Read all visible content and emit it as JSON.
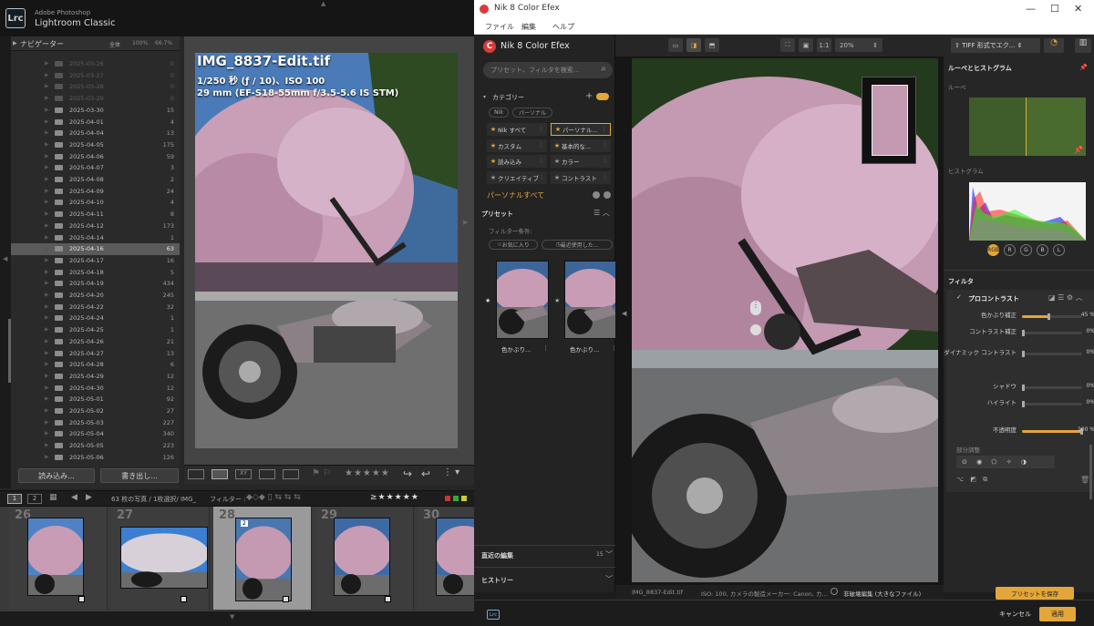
{
  "lightroom": {
    "brand_line1": "Adobe Photoshop",
    "brand_line2": "Lightroom Classic",
    "logo_text": "Lrc",
    "navigator": {
      "title": "ナビゲーター",
      "zoom_fit": "全体",
      "zoom_100": "100%",
      "zoom_667": "66.7%"
    },
    "folders": [
      {
        "name": "2025-03-26",
        "count": "0",
        "dim": true
      },
      {
        "name": "2025-03-27",
        "count": "0",
        "dim": true
      },
      {
        "name": "2025-03-28",
        "count": "0",
        "dim": true
      },
      {
        "name": "2025-03-29",
        "count": "0",
        "dim": true
      },
      {
        "name": "2025-03-30",
        "count": "15"
      },
      {
        "name": "2025-04-01",
        "count": "4"
      },
      {
        "name": "2025-04-04",
        "count": "13"
      },
      {
        "name": "2025-04-05",
        "count": "175"
      },
      {
        "name": "2025-04-06",
        "count": "59"
      },
      {
        "name": "2025-04-07",
        "count": "3"
      },
      {
        "name": "2025-04-08",
        "count": "2"
      },
      {
        "name": "2025-04-09",
        "count": "24"
      },
      {
        "name": "2025-04-10",
        "count": "4"
      },
      {
        "name": "2025-04-11",
        "count": "8"
      },
      {
        "name": "2025-04-12",
        "count": "173"
      },
      {
        "name": "2025-04-14",
        "count": "1"
      },
      {
        "name": "2025-04-16",
        "count": "63",
        "selected": true
      },
      {
        "name": "2025-04-17",
        "count": "16"
      },
      {
        "name": "2025-04-18",
        "count": "5"
      },
      {
        "name": "2025-04-19",
        "count": "434"
      },
      {
        "name": "2025-04-20",
        "count": "245"
      },
      {
        "name": "2025-04-22",
        "count": "32"
      },
      {
        "name": "2025-04-24",
        "count": "1"
      },
      {
        "name": "2025-04-25",
        "count": "1"
      },
      {
        "name": "2025-04-26",
        "count": "21"
      },
      {
        "name": "2025-04-27",
        "count": "13"
      },
      {
        "name": "2025-04-28",
        "count": "6"
      },
      {
        "name": "2025-04-29",
        "count": "12"
      },
      {
        "name": "2025-04-30",
        "count": "12"
      },
      {
        "name": "2025-05-01",
        "count": "92"
      },
      {
        "name": "2025-05-02",
        "count": "27"
      },
      {
        "name": "2025-05-03",
        "count": "227"
      },
      {
        "name": "2025-05-04",
        "count": "340"
      },
      {
        "name": "2025-05-05",
        "count": "223"
      },
      {
        "name": "2025-05-06",
        "count": "126"
      }
    ],
    "import_button": "読み込み...",
    "export_button": "書き出し...",
    "overlay": {
      "title": "IMG_8837-Edit.tif",
      "line1": "1/250 秒 (ƒ / 10)、ISO 100",
      "line2": "29 mm (EF-S18-55mm f/3.5-5.6 IS STM)"
    },
    "filmbar": {
      "page1": "1",
      "page2": "2",
      "info": "63 枚の写真 / 1枚選択/ IMG_",
      "filter_label": "フィルター :"
    },
    "filmstrip": [
      {
        "num": "26"
      },
      {
        "num": "27"
      },
      {
        "num": "28",
        "selected": true,
        "badge": "2"
      },
      {
        "num": "29"
      },
      {
        "num": "30"
      }
    ]
  },
  "nik": {
    "window_title": "Nik 8 Color Efex",
    "menu": [
      "ファイル",
      "編集",
      "ヘルプ"
    ],
    "app_name": "Nik 8 Color Efex",
    "search_placeholder": "プリセット、フィルタを検索...",
    "category_title": "カテゴリー",
    "tabs": [
      "Nik",
      "パーソナル"
    ],
    "categories": [
      {
        "label": "Nik すべて",
        "star": "gold"
      },
      {
        "label": "パーソナル...",
        "star": "gold",
        "selected": true
      },
      {
        "label": "カスタム",
        "star": "gold"
      },
      {
        "label": "基本的な...",
        "star": "gold"
      },
      {
        "label": "読み込み",
        "star": "gold"
      },
      {
        "label": "カラー",
        "star": "dark"
      },
      {
        "label": "クリエイティブ",
        "star": "dark"
      },
      {
        "label": "コントラスト",
        "star": "dark"
      }
    ],
    "personal_all": "パーソナルすべて",
    "presets_title": "プリセット",
    "filter_condition": "フィルター条件:",
    "filter_favorites": "お気に入り",
    "filter_recent": "最近使用した...",
    "preset_thumbs": [
      "色かぶり...",
      "色かぶり..."
    ],
    "recent_edits": "直近の編集",
    "recent_count": "15",
    "history": "ヒストリー",
    "zoom": "20%",
    "status_file": "IMG_8837-Edit.tif",
    "status_info": "ISO: 100, カメラの製造メーカー: Canon, カ...",
    "nondestructive": "非破壊編集 (大きなファイル)",
    "export_format": "TIFF 形式でエク...",
    "loupe_hist_title": "ルーペとヒストグラム",
    "loupe_label": "ルーペ",
    "histogram_label": "ヒストグラム",
    "channels": [
      "RGB",
      "R",
      "G",
      "B",
      "L"
    ],
    "filter_title": "フィルタ",
    "filter_name": "プロコントラスト",
    "sliders": [
      {
        "label": "色かぶり補正",
        "value": "45 %",
        "fraction": 0.45
      },
      {
        "label": "コントラスト補正",
        "value": "0%",
        "fraction": 0
      },
      {
        "label": "ダイナミック コントラスト",
        "value": "0%",
        "fraction": 0
      },
      {
        "label": "シャドウ",
        "value": "0%",
        "fraction": 0
      },
      {
        "label": "ハイライト",
        "value": "0%",
        "fraction": 0
      },
      {
        "label": "不透明度",
        "value": "100 %",
        "fraction": 1
      }
    ],
    "partial_adjust": "部分調整",
    "save_preset": "プリセットを保存",
    "cancel": "キャンセル",
    "apply": "適用",
    "bottom_logo": "Lrc",
    "colors": {
      "accent": "#e2a63a",
      "brand": "#d93a3a"
    }
  }
}
